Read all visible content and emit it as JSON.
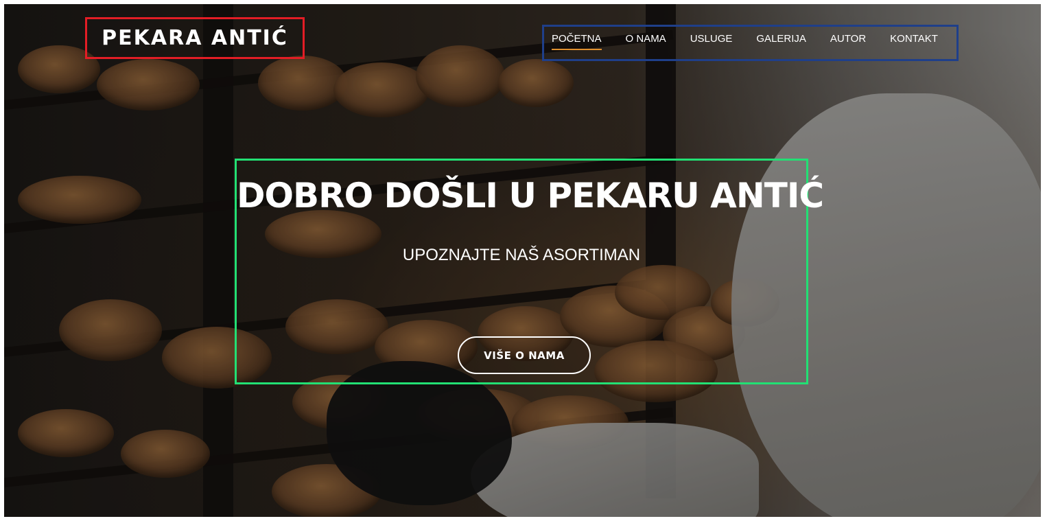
{
  "header": {
    "logo": "PEKARA ANTIĆ",
    "nav": [
      {
        "label": "POČETNA",
        "active": true
      },
      {
        "label": "O NAMA",
        "active": false
      },
      {
        "label": "USLUGE",
        "active": false
      },
      {
        "label": "GALERIJA",
        "active": false
      },
      {
        "label": "AUTOR",
        "active": false
      },
      {
        "label": "KONTAKT",
        "active": false
      }
    ]
  },
  "hero": {
    "title": "DOBRO DOŠLI U PEKARU ANTIĆ",
    "subtitle": "UPOZNAJTE NAŠ ASORTIMAN",
    "button_label": "VIŠE O NAMA"
  },
  "colors": {
    "logo_outline": "#e31d25",
    "nav_outline": "#1f3f8a",
    "hero_outline": "#22e074",
    "active_underline": "#e0902f"
  }
}
